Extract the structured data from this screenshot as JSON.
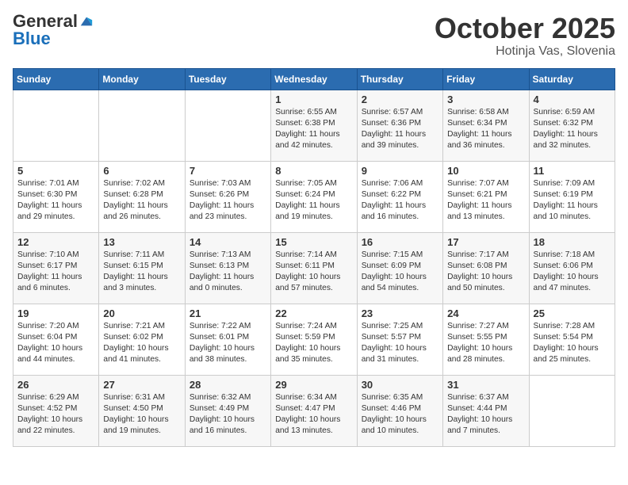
{
  "header": {
    "logo_general": "General",
    "logo_blue": "Blue",
    "month": "October 2025",
    "location": "Hotinja Vas, Slovenia"
  },
  "weekdays": [
    "Sunday",
    "Monday",
    "Tuesday",
    "Wednesday",
    "Thursday",
    "Friday",
    "Saturday"
  ],
  "weeks": [
    [
      {
        "day": "",
        "text": ""
      },
      {
        "day": "",
        "text": ""
      },
      {
        "day": "",
        "text": ""
      },
      {
        "day": "1",
        "text": "Sunrise: 6:55 AM\nSunset: 6:38 PM\nDaylight: 11 hours and 42 minutes."
      },
      {
        "day": "2",
        "text": "Sunrise: 6:57 AM\nSunset: 6:36 PM\nDaylight: 11 hours and 39 minutes."
      },
      {
        "day": "3",
        "text": "Sunrise: 6:58 AM\nSunset: 6:34 PM\nDaylight: 11 hours and 36 minutes."
      },
      {
        "day": "4",
        "text": "Sunrise: 6:59 AM\nSunset: 6:32 PM\nDaylight: 11 hours and 32 minutes."
      }
    ],
    [
      {
        "day": "5",
        "text": "Sunrise: 7:01 AM\nSunset: 6:30 PM\nDaylight: 11 hours and 29 minutes."
      },
      {
        "day": "6",
        "text": "Sunrise: 7:02 AM\nSunset: 6:28 PM\nDaylight: 11 hours and 26 minutes."
      },
      {
        "day": "7",
        "text": "Sunrise: 7:03 AM\nSunset: 6:26 PM\nDaylight: 11 hours and 23 minutes."
      },
      {
        "day": "8",
        "text": "Sunrise: 7:05 AM\nSunset: 6:24 PM\nDaylight: 11 hours and 19 minutes."
      },
      {
        "day": "9",
        "text": "Sunrise: 7:06 AM\nSunset: 6:22 PM\nDaylight: 11 hours and 16 minutes."
      },
      {
        "day": "10",
        "text": "Sunrise: 7:07 AM\nSunset: 6:21 PM\nDaylight: 11 hours and 13 minutes."
      },
      {
        "day": "11",
        "text": "Sunrise: 7:09 AM\nSunset: 6:19 PM\nDaylight: 11 hours and 10 minutes."
      }
    ],
    [
      {
        "day": "12",
        "text": "Sunrise: 7:10 AM\nSunset: 6:17 PM\nDaylight: 11 hours and 6 minutes."
      },
      {
        "day": "13",
        "text": "Sunrise: 7:11 AM\nSunset: 6:15 PM\nDaylight: 11 hours and 3 minutes."
      },
      {
        "day": "14",
        "text": "Sunrise: 7:13 AM\nSunset: 6:13 PM\nDaylight: 11 hours and 0 minutes."
      },
      {
        "day": "15",
        "text": "Sunrise: 7:14 AM\nSunset: 6:11 PM\nDaylight: 10 hours and 57 minutes."
      },
      {
        "day": "16",
        "text": "Sunrise: 7:15 AM\nSunset: 6:09 PM\nDaylight: 10 hours and 54 minutes."
      },
      {
        "day": "17",
        "text": "Sunrise: 7:17 AM\nSunset: 6:08 PM\nDaylight: 10 hours and 50 minutes."
      },
      {
        "day": "18",
        "text": "Sunrise: 7:18 AM\nSunset: 6:06 PM\nDaylight: 10 hours and 47 minutes."
      }
    ],
    [
      {
        "day": "19",
        "text": "Sunrise: 7:20 AM\nSunset: 6:04 PM\nDaylight: 10 hours and 44 minutes."
      },
      {
        "day": "20",
        "text": "Sunrise: 7:21 AM\nSunset: 6:02 PM\nDaylight: 10 hours and 41 minutes."
      },
      {
        "day": "21",
        "text": "Sunrise: 7:22 AM\nSunset: 6:01 PM\nDaylight: 10 hours and 38 minutes."
      },
      {
        "day": "22",
        "text": "Sunrise: 7:24 AM\nSunset: 5:59 PM\nDaylight: 10 hours and 35 minutes."
      },
      {
        "day": "23",
        "text": "Sunrise: 7:25 AM\nSunset: 5:57 PM\nDaylight: 10 hours and 31 minutes."
      },
      {
        "day": "24",
        "text": "Sunrise: 7:27 AM\nSunset: 5:55 PM\nDaylight: 10 hours and 28 minutes."
      },
      {
        "day": "25",
        "text": "Sunrise: 7:28 AM\nSunset: 5:54 PM\nDaylight: 10 hours and 25 minutes."
      }
    ],
    [
      {
        "day": "26",
        "text": "Sunrise: 6:29 AM\nSunset: 4:52 PM\nDaylight: 10 hours and 22 minutes."
      },
      {
        "day": "27",
        "text": "Sunrise: 6:31 AM\nSunset: 4:50 PM\nDaylight: 10 hours and 19 minutes."
      },
      {
        "day": "28",
        "text": "Sunrise: 6:32 AM\nSunset: 4:49 PM\nDaylight: 10 hours and 16 minutes."
      },
      {
        "day": "29",
        "text": "Sunrise: 6:34 AM\nSunset: 4:47 PM\nDaylight: 10 hours and 13 minutes."
      },
      {
        "day": "30",
        "text": "Sunrise: 6:35 AM\nSunset: 4:46 PM\nDaylight: 10 hours and 10 minutes."
      },
      {
        "day": "31",
        "text": "Sunrise: 6:37 AM\nSunset: 4:44 PM\nDaylight: 10 hours and 7 minutes."
      },
      {
        "day": "",
        "text": ""
      }
    ]
  ]
}
